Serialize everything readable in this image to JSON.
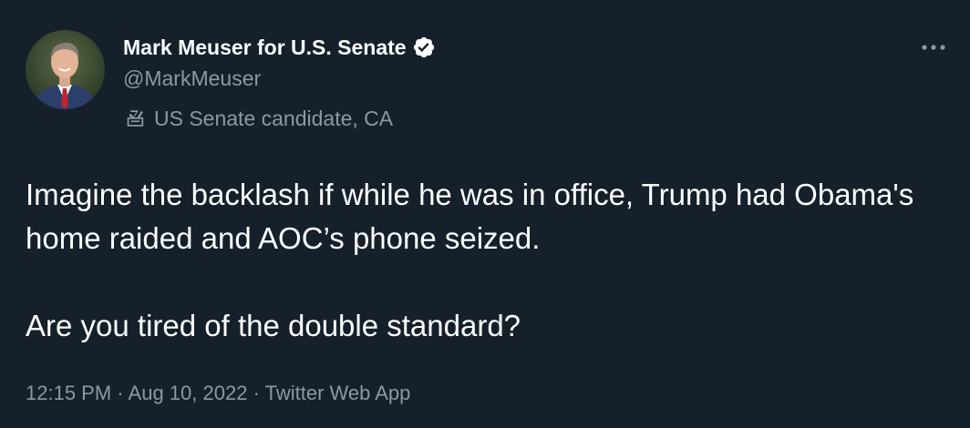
{
  "author": {
    "display_name": "Mark Meuser for U.S. Senate",
    "handle": "@MarkMeuser",
    "verified_icon": "verified-badge-icon",
    "label": "US Senate candidate, CA",
    "label_icon": "ballot-box-icon",
    "avatar_icon": "profile-photo"
  },
  "more_icon": "more-options-icon",
  "tweet": {
    "paragraphs": [
      "Imagine the backlash if while he was in office, Trump had Obama's home raided and AOC’s phone seized.",
      "Are you tired of the double standard?"
    ]
  },
  "meta": {
    "time": "12:15 PM",
    "separator": "·",
    "date": "Aug 10, 2022",
    "source": "Twitter Web App"
  },
  "colors": {
    "background": "#15202b",
    "primary_text": "#ffffff",
    "secondary_text": "#8b98a5"
  }
}
